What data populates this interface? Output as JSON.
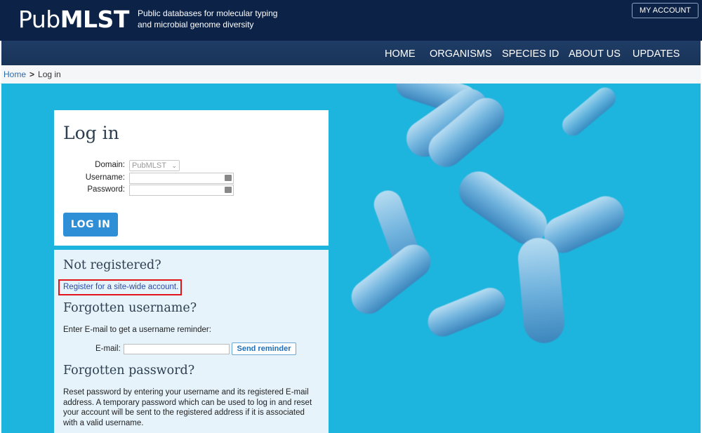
{
  "header": {
    "logo_pub": "Pub",
    "logo_mlst": "MLST",
    "tagline": "Public databases for molecular typing and microbial genome diversity",
    "account_button": "MY ACCOUNT"
  },
  "nav": {
    "items": [
      {
        "label": "HOME"
      },
      {
        "label": "ORGANISMS"
      },
      {
        "label": "SPECIES ID"
      },
      {
        "label": "ABOUT US"
      },
      {
        "label": "UPDATES"
      }
    ]
  },
  "breadcrumb": {
    "home": "Home",
    "separator": ">",
    "current": "Log in"
  },
  "login": {
    "title": "Log in",
    "domain_label": "Domain:",
    "domain_value": "PubMLST",
    "username_label": "Username:",
    "username_value": "",
    "password_label": "Password:",
    "password_value": "",
    "submit": "LOG IN"
  },
  "help": {
    "not_registered_heading": "Not registered?",
    "register_link": "Register for a site-wide account.",
    "forgot_username_heading": "Forgotten username?",
    "forgot_username_text": "Enter E-mail to get a username reminder:",
    "email_label": "E-mail:",
    "email_value": "",
    "send_reminder": "Send reminder",
    "forgot_password_heading": "Forgotten password?",
    "forgot_password_text": "Reset password by entering your username and its registered E-mail address. A temporary password which can be used to log in and reset your account will be sent to the registered address if it is associated with a valid username."
  },
  "colors": {
    "header_bg": "#0c2347",
    "nav_bg": "#1e3c66",
    "hero_bg": "#1db5dd",
    "login_button": "#2e8fd6",
    "help_card_bg": "#e6f3fb",
    "highlight_border": "#e0141a"
  },
  "icons": {
    "select_chevron": "chevron-down-icon",
    "password_manager": "key-icon"
  }
}
